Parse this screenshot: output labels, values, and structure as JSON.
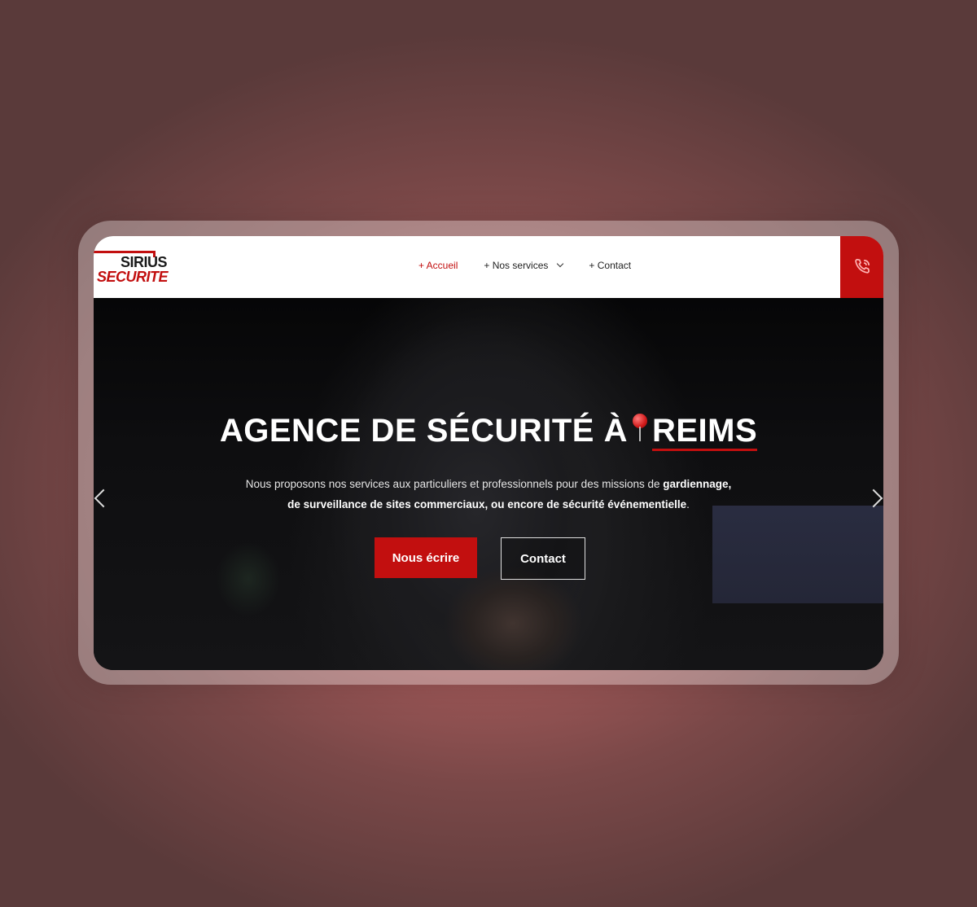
{
  "brand": {
    "name_top": "SIRIUS",
    "name_bottom": "SECURITE",
    "accent": "#c20f0f"
  },
  "nav": {
    "items": [
      {
        "label": "+ Accueil",
        "active": true
      },
      {
        "label": "+ Nos services",
        "has_dropdown": true
      },
      {
        "label": "+ Contact"
      }
    ]
  },
  "header": {
    "phone_icon": "phone-icon"
  },
  "hero": {
    "headline_part1": "AGENCE DE SÉCURITÉ À",
    "headline_city": "REIMS",
    "pin_icon": "map-pin-icon",
    "lede_intro": "Nous proposons nos services aux particuliers et professionnels pour des missions de",
    "lede_bold1": "gardiennage,",
    "lede_bold2": "de surveillance de sites commerciaux, ou encore de sécurité événementielle",
    "lede_end": ".",
    "cta_primary": "Nous écrire",
    "cta_secondary": "Contact"
  },
  "slider": {
    "prev_icon": "chevron-left-icon",
    "next_icon": "chevron-right-icon"
  }
}
